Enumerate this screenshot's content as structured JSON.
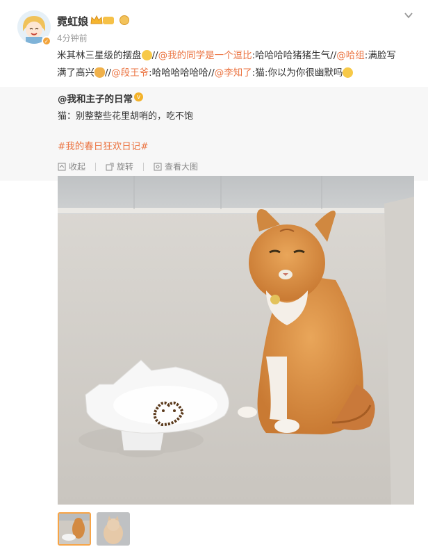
{
  "post": {
    "username": "霓虹娘",
    "time": "4分钟前",
    "text": {
      "t1": "米其林三星级的摆盘",
      "s1": "//",
      "m1": "@我的同学是一个逗比",
      "t2": ":哈哈哈哈猪猪生气",
      "s2": "//",
      "m2": "@哈组",
      "t3": ":满脸写满了高兴",
      "s3": "//",
      "m3": "@段王爷",
      "t4": ":哈哈哈哈哈哈",
      "s4": "//",
      "m4": "@李知了",
      "t5": ":猫:你以为你很幽默吗"
    }
  },
  "repost": {
    "author": "@我和主子的日常",
    "text": "猫：别整整些花里胡哨的，吃不饱",
    "topic": "#我的春日狂欢日记#",
    "actions": {
      "collect": "收起",
      "rotate": "旋转",
      "view_large": "查看大图"
    }
  },
  "colors": {
    "link": "#eb7340",
    "repost_bg": "#f7f7f7",
    "thumb_active": "#f7a446"
  },
  "icons": [
    "chevron-down-icon",
    "crown-icon",
    "verified-icon",
    "collect-icon",
    "rotate-icon",
    "view-large-icon"
  ]
}
